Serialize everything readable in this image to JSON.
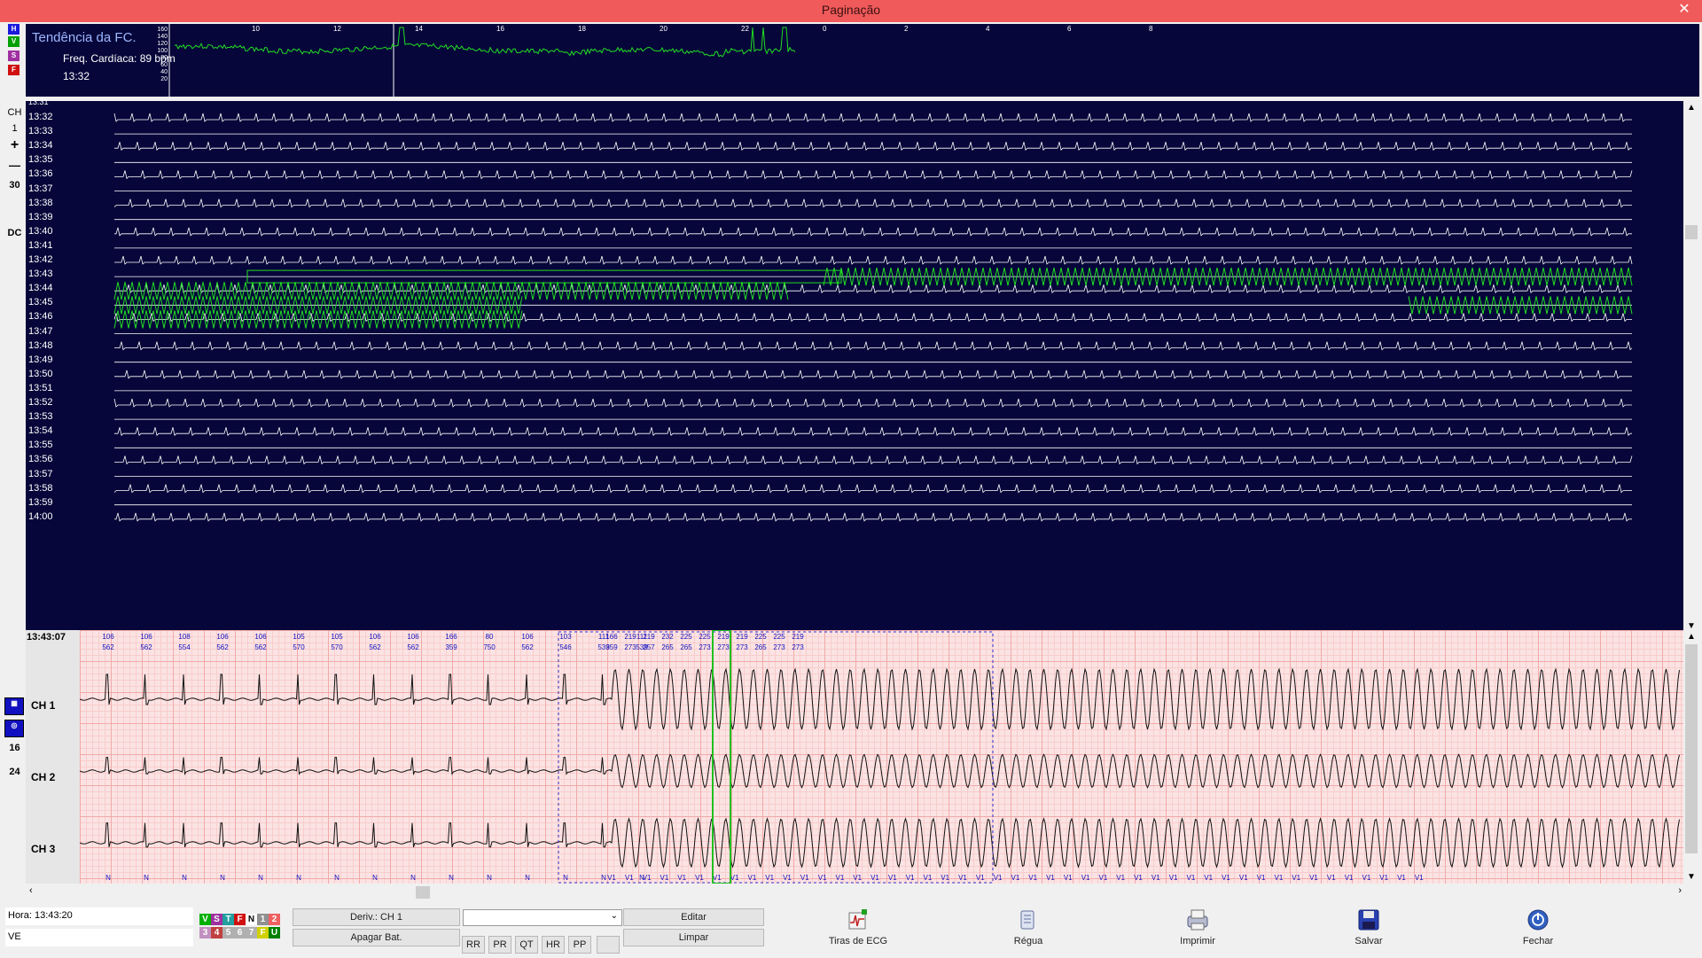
{
  "window": {
    "title": "Paginação",
    "close_glyph": "✕"
  },
  "left_toolbar": {
    "mode_buttons": [
      {
        "label": "H",
        "color": "#1a1adc"
      },
      {
        "label": "V",
        "color": "#00a000"
      },
      {
        "label": "S",
        "color": "#a030a0"
      },
      {
        "label": "F",
        "color": "#d01010"
      }
    ],
    "channel_label": "CH",
    "channel_value": "1",
    "plus": "+",
    "minus": "—",
    "scale": "30",
    "coupling": "DC"
  },
  "trend": {
    "title": "Tendência da FC.",
    "hr_text": "Freq. Cardíaca: 89 bpm",
    "time": "13:32",
    "y_ticks": [
      "160",
      "140",
      "120",
      "100",
      "80",
      "60",
      "40",
      "20"
    ],
    "x_ticks": [
      "10",
      "12",
      "14",
      "16",
      "18",
      "20",
      "22",
      "0",
      "2",
      "4",
      "6",
      "8"
    ]
  },
  "page_view": {
    "first_row_time": "13:31",
    "time_labels": [
      "13:32",
      "13:33",
      "13:34",
      "13:35",
      "13:36",
      "13:37",
      "13:38",
      "13:39",
      "13:40",
      "13:41",
      "13:42",
      "13:43",
      "13:44",
      "13:45",
      "13:46",
      "13:47",
      "13:48",
      "13:49",
      "13:50",
      "13:51",
      "13:52",
      "13:53",
      "13:54",
      "13:55",
      "13:56",
      "13:57",
      "13:58",
      "13:59",
      "14:00"
    ],
    "trace_color": "#ffffff",
    "event_color": "#22dd22"
  },
  "strip": {
    "time": "13:43:07",
    "channels": [
      "CH 1",
      "CH 2",
      "CH 3"
    ],
    "side_buttons": [
      "16",
      "24"
    ],
    "hr_values": [
      "106",
      "106",
      "108",
      "106",
      "106",
      "105",
      "105",
      "106",
      "106",
      "166",
      "80",
      "106",
      "103",
      "111",
      "111",
      "166",
      "219",
      "219",
      "232",
      "225",
      "225",
      "219",
      "219",
      "225",
      "225",
      "219"
    ],
    "rr_values": [
      "562",
      "562",
      "554",
      "562",
      "562",
      "570",
      "570",
      "562",
      "562",
      "359",
      "750",
      "562",
      "546",
      "539",
      "539",
      "359",
      "273",
      "257",
      "265",
      "265",
      "273",
      "273",
      "273",
      "265",
      "273",
      "273"
    ],
    "beat_labels": [
      "N",
      "N",
      "N",
      "N",
      "N",
      "N",
      "N",
      "N",
      "N",
      "N",
      "N",
      "N",
      "N",
      "N",
      "N",
      "V1",
      "V1",
      "V1",
      "V1",
      "V1",
      "V1",
      "V1",
      "V1",
      "V1",
      "V1",
      "V1",
      "V1",
      "V1",
      "V1",
      "V1",
      "V1",
      "V1",
      "V1",
      "V1",
      "V1",
      "V1",
      "V1",
      "V1",
      "V1",
      "V1",
      "V1",
      "V1",
      "V1",
      "V1",
      "V1",
      "V1",
      "V1",
      "V1",
      "V1",
      "V1",
      "V1",
      "V1",
      "V1",
      "V1",
      "V1",
      "V1",
      "V1",
      "V1",
      "V1",
      "V1",
      "V1",
      "V1"
    ],
    "grid_color": "#fbe3e3"
  },
  "status": {
    "time_text": "Hora: 13:43:20",
    "rhythm_text": "VE"
  },
  "beat_codes": [
    {
      "label": "V",
      "color": "#00b000"
    },
    {
      "label": "S",
      "color": "#a030a0"
    },
    {
      "label": "T",
      "color": "#20a0a0"
    },
    {
      "label": "F",
      "color": "#d01010"
    },
    {
      "label": "N",
      "color": "#ffffff"
    },
    {
      "label": "1",
      "color": "#909090"
    },
    {
      "label": "2",
      "color": "#f06060"
    },
    {
      "label": "3",
      "color": "#c090c0"
    },
    {
      "label": "4",
      "color": "#c04040"
    },
    {
      "label": "5",
      "color": "#b0b0b0"
    },
    {
      "label": "6",
      "color": "#b0b0b0"
    },
    {
      "label": "7",
      "color": "#b0b0b0"
    },
    {
      "label": "F",
      "color": "#d0d000"
    },
    {
      "label": "U",
      "color": "#008000"
    }
  ],
  "controls": {
    "deriv_label": "Deriv.: CH 1",
    "delete_beat_label": "Apagar Bat.",
    "dropdown_value": "",
    "edit_label": "Editar",
    "clear_label": "Limpar",
    "measure_buttons": [
      "RR",
      "PR",
      "QT",
      "HR",
      "PP"
    ]
  },
  "toolbar": {
    "ecg_strips": "Tiras de ECG",
    "ruler": "Régua",
    "print": "Imprimir",
    "save": "Salvar",
    "close": "Fechar"
  }
}
